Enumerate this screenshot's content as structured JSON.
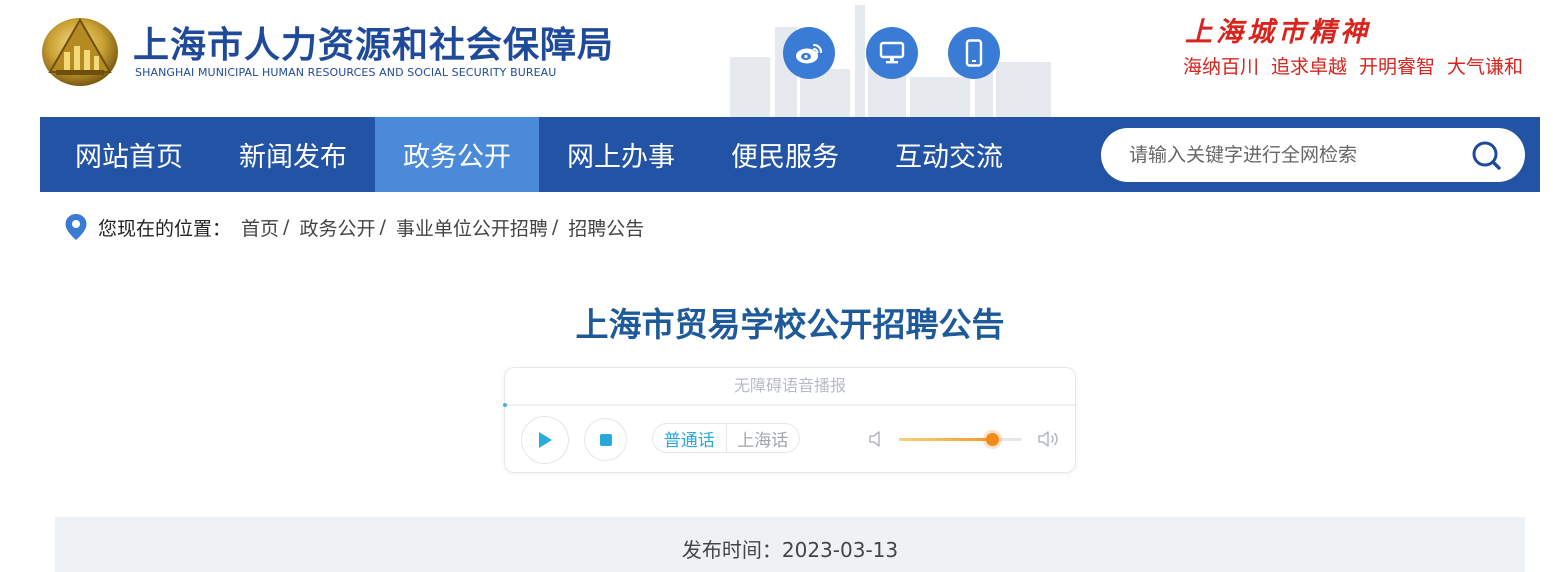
{
  "header": {
    "title": "上海市人力资源和社会保障局",
    "subtitle": "SHANGHAI MUNICIPAL HUMAN RESOURCES AND SOCIAL SECURITY BUREAU",
    "icons": [
      "weibo-icon",
      "monitor-icon",
      "mobile-icon"
    ],
    "spirit": {
      "title": "上海城市精神",
      "items": [
        "海纳百川",
        "追求卓越",
        "开明睿智",
        "大气谦和"
      ]
    }
  },
  "nav": {
    "items": [
      "网站首页",
      "新闻发布",
      "政务公开",
      "网上办事",
      "便民服务",
      "互动交流"
    ],
    "active_index": 2,
    "search_placeholder": "请输入关键字进行全网检索"
  },
  "breadcrumb": {
    "label": "您现在的位置：",
    "items": [
      "首页",
      "政务公开",
      "事业单位公开招聘",
      "招聘公告"
    ],
    "separator": "/"
  },
  "article": {
    "title": "上海市贸易学校公开招聘公告",
    "player": {
      "title": "无障碍语音播报",
      "lang_options": [
        "普通话",
        "上海话"
      ],
      "selected_lang": "普通话",
      "volume_fraction": 0.76
    },
    "publish_label": "发布时间：",
    "publish_date": "2023-03-13"
  },
  "colors": {
    "brand_blue": "#2253a5",
    "nav_active": "#4a8ad8",
    "spirit_red": "#d9231d",
    "title_blue": "#1e5a99"
  }
}
